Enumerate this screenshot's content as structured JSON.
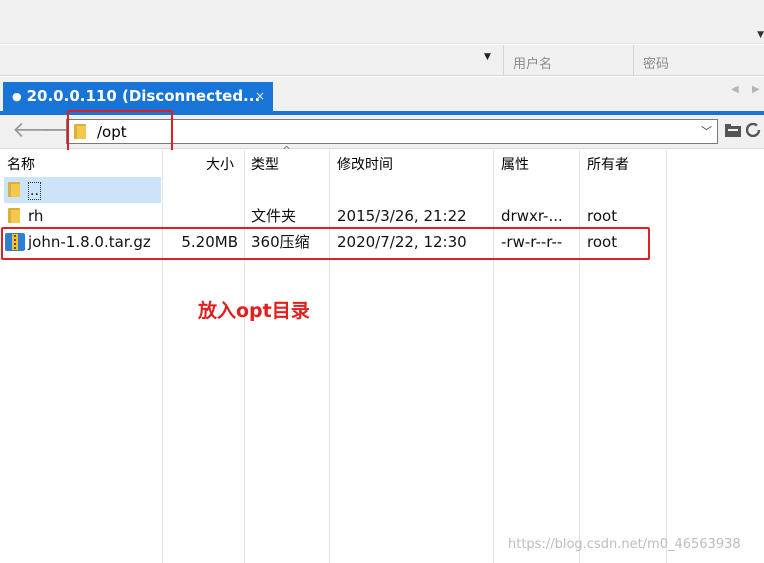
{
  "credentials": {
    "username_placeholder": "用户名",
    "password_placeholder": "密码"
  },
  "tab": {
    "title": "20.0.0.110 (Disconnected...",
    "close_glyph": "×"
  },
  "address": {
    "path": "/opt"
  },
  "columns": {
    "name": "名称",
    "size": "大小",
    "type": "类型",
    "modified": "修改时间",
    "attributes": "属性",
    "owner": "所有者"
  },
  "files": [
    {
      "name": "..",
      "size": "",
      "type": "",
      "modified": "",
      "attributes": "",
      "owner": "",
      "icon": "folder-icon",
      "selected": true
    },
    {
      "name": "rh",
      "size": "",
      "type": "文件夹",
      "modified": "2015/3/26, 21:22",
      "attributes": "drwxr-...",
      "owner": "root",
      "icon": "folder-icon",
      "selected": false
    },
    {
      "name": "john-1.8.0.tar.gz",
      "size": "5.20MB",
      "type": "360压缩",
      "modified": "2020/7/22, 12:30",
      "attributes": "-rw-r--r--",
      "owner": "root",
      "icon": "archive-icon",
      "selected": false
    }
  ],
  "annotation": {
    "text": "放入opt目录",
    "color": "#e02020"
  },
  "watermark": "https://blog.csdn.net/m0_46563938",
  "colors": {
    "accent": "#1874d6",
    "selection": "#cce4f7",
    "highlight": "#e02020"
  }
}
